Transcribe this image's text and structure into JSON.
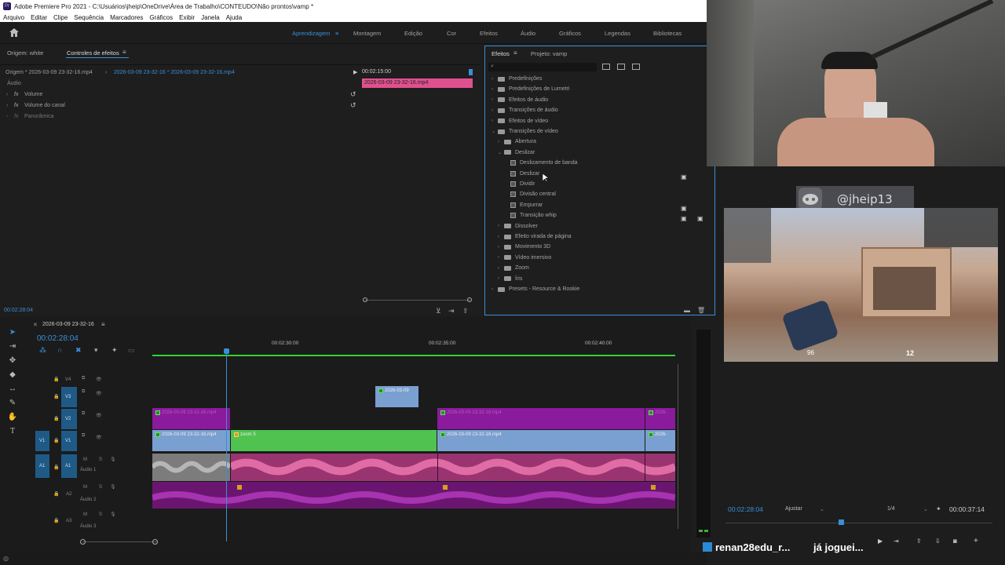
{
  "window": {
    "title": "Adobe Premiere Pro 2021 - C:\\Usuários\\jheip\\OneDrive\\Área de Trabalho\\CONTEUDO\\Não prontos\\vamp *",
    "app_badge": "Pr"
  },
  "menu": [
    "Arquivo",
    "Editar",
    "Clipe",
    "Sequência",
    "Marcadores",
    "Gráficos",
    "Exibir",
    "Janela",
    "Ajuda"
  ],
  "workspaces": [
    {
      "label": "Aprendizagem",
      "active": true
    },
    {
      "label": "Montagem",
      "active": false
    },
    {
      "label": "Edição",
      "active": false
    },
    {
      "label": "Cor",
      "active": false
    },
    {
      "label": "Efeitos",
      "active": false
    },
    {
      "label": "Áudio",
      "active": false
    },
    {
      "label": "Gráficos",
      "active": false
    },
    {
      "label": "Legendas",
      "active": false
    },
    {
      "label": "Bibliotecas",
      "active": false
    }
  ],
  "effect_controls": {
    "tab_source": "Origem: white",
    "tab_active": "Controles de efeitos",
    "source_clip": "Origem * 2026-03-09 23-32-16.mp4",
    "sequence_clip": "2026-03-09 23-32-16 * 2026-03-09 23-32-16.mp4",
    "timecode_ruler": "00:02:15:00",
    "clip_bar": "2026-03-09 23-32-16.mp4",
    "section": "Áudio",
    "rows": [
      "Volume",
      "Volume do canal",
      "Panorâmica"
    ],
    "fx_label": "fx",
    "playhead_time": "00:02:28:04"
  },
  "effects_panel": {
    "tab_active": "Efeitos",
    "tab_project": "Projeto: vamp",
    "items": [
      {
        "label": "Predefinições",
        "indent": 0,
        "kind": "folder",
        "exp": "›"
      },
      {
        "label": "Predefinições de Lumetri",
        "indent": 0,
        "kind": "folder",
        "exp": "›"
      },
      {
        "label": "Efeitos de áudio",
        "indent": 0,
        "kind": "folder",
        "exp": "›"
      },
      {
        "label": "Transições de áudio",
        "indent": 0,
        "kind": "folder",
        "exp": "›"
      },
      {
        "label": "Efeitos de vídeo",
        "indent": 0,
        "kind": "folder",
        "exp": "›"
      },
      {
        "label": "Transições de vídeo",
        "indent": 0,
        "kind": "folder",
        "exp": "⌄"
      },
      {
        "label": "Abertura",
        "indent": 1,
        "kind": "folder",
        "exp": "›"
      },
      {
        "label": "Deslizar",
        "indent": 1,
        "kind": "folder",
        "exp": "⌄"
      },
      {
        "label": "Deslizamento de banda",
        "indent": 2,
        "kind": "fx",
        "exp": ""
      },
      {
        "label": "Deslizar",
        "indent": 2,
        "kind": "fx",
        "exp": ""
      },
      {
        "label": "Dividir",
        "indent": 2,
        "kind": "fx",
        "exp": ""
      },
      {
        "label": "Divisão central",
        "indent": 2,
        "kind": "fx",
        "exp": ""
      },
      {
        "label": "Empurrar",
        "indent": 2,
        "kind": "fx",
        "exp": ""
      },
      {
        "label": "Transição whip",
        "indent": 2,
        "kind": "fx",
        "exp": ""
      },
      {
        "label": "Dissolver",
        "indent": 1,
        "kind": "folder",
        "exp": "›"
      },
      {
        "label": "Efeito virada de página",
        "indent": 1,
        "kind": "folder",
        "exp": "›"
      },
      {
        "label": "Movimento 3D",
        "indent": 1,
        "kind": "folder",
        "exp": "›"
      },
      {
        "label": "Vídeo imersivo",
        "indent": 1,
        "kind": "folder",
        "exp": "›"
      },
      {
        "label": "Zoom",
        "indent": 1,
        "kind": "folder",
        "exp": "›"
      },
      {
        "label": "Íris",
        "indent": 1,
        "kind": "folder",
        "exp": "›"
      },
      {
        "label": "Presets - Resource & Rookie",
        "indent": 0,
        "kind": "folder",
        "exp": "›"
      }
    ]
  },
  "timeline": {
    "sequence": "2026-03-09 23-32-16",
    "timecode": "00:02:28:04",
    "ruler": [
      "00:02:30:00",
      "00:02:35:00",
      "00:02:40:00"
    ],
    "video_tracks": [
      "V4",
      "V3",
      "V2",
      "V1"
    ],
    "audio_tracks": [
      {
        "id": "A1",
        "name": "Áudio 1"
      },
      {
        "id": "A2",
        "name": "Áudio 2"
      },
      {
        "id": "A3",
        "name": "Áudio 3"
      }
    ],
    "source_patch_v": "V1",
    "source_patch_a": "A1",
    "track_buttons": [
      "M",
      "S"
    ],
    "clips": {
      "v3": "2026-03-09",
      "v2a": "2026-03-09 23-32-16.mp4",
      "v2b": "2026-03-09 23-32-16.mp4",
      "v2c": "2026-",
      "v1a": "2026-03-09 23-32-16.mp4",
      "v1b": "zoom 5",
      "v1c": "2026-03-09 23-32-16.mp4",
      "v1d": "2026-"
    }
  },
  "program_monitor": {
    "timecode": "00:02:28:04",
    "fit": "Ajustar",
    "quality": "1/4",
    "duration": "00:00:37:14"
  },
  "stream_overlay": {
    "handle": "@jheip13",
    "chat_user": "renan28edu_r...",
    "chat_msg": "já joguei...",
    "game_ammo": "12",
    "game_hp": "96"
  },
  "colors": {
    "accent": "#3a8fd9",
    "clip_green": "#4fc24f",
    "clip_blue": "#7a9fd1",
    "clip_purple": "#8b1a9c",
    "clip_pink": "#e0508f",
    "audio_pink": "#c24a84",
    "audio_purple": "#7a1a7e"
  }
}
